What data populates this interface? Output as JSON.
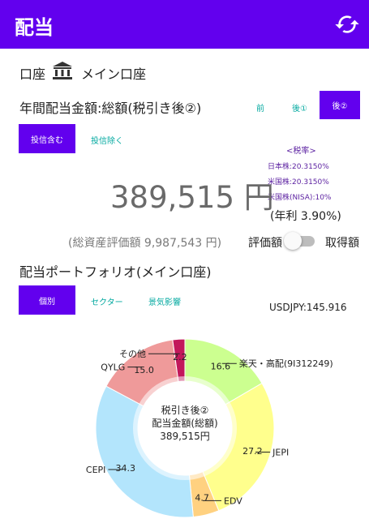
{
  "app": {
    "title": "配当",
    "refresh_icon": "refresh-icon",
    "accent": "#6200ee"
  },
  "account": {
    "label": "口座",
    "icon": "bank-icon",
    "name": "メイン口座"
  },
  "dividend": {
    "title": "年間配当金額:総額(税引き後②)",
    "tabs": [
      "前",
      "後①",
      "後②"
    ],
    "active_tab": "後②",
    "filter": {
      "include": "投信含む",
      "exclude": "投信除く"
    },
    "amount": "389,515 円",
    "annual_rate": "(年利 3.90%)",
    "total_assets": "(総資産評価額 9,987,543 円)",
    "toggle": {
      "left": "評価額",
      "right": "取得額",
      "on": false
    }
  },
  "tax": {
    "title": "<税率>",
    "jp": "日本株:20.3150%",
    "us": "米国株:20.3150%",
    "nisa": "米国株(NISA):10%"
  },
  "portfolio": {
    "title": "配当ポートフォリオ(メイン口座)",
    "tabs": [
      "個別",
      "セクター",
      "景気影響"
    ],
    "active_tab": "個別",
    "usdjpy": "USDJPY:145.916"
  },
  "chart_data": {
    "type": "pie",
    "center_text": [
      "税引き後②",
      "配当金額(総額)",
      "389,515円"
    ],
    "slices": [
      {
        "label": "楽天・高配(9I312249)",
        "value": 16.6,
        "color": "#ccff90"
      },
      {
        "label": "JEPI",
        "value": 27.2,
        "color": "#ffff8d"
      },
      {
        "label": "EDV",
        "value": 4.7,
        "color": "#ffd180"
      },
      {
        "label": "CEPI",
        "value": 34.3,
        "color": "#b3e5fc"
      },
      {
        "label": "QYLG",
        "value": 15.0,
        "color": "#ef9a9a"
      },
      {
        "label": "その他",
        "value": 2.2,
        "color": "#c2185b"
      }
    ]
  }
}
